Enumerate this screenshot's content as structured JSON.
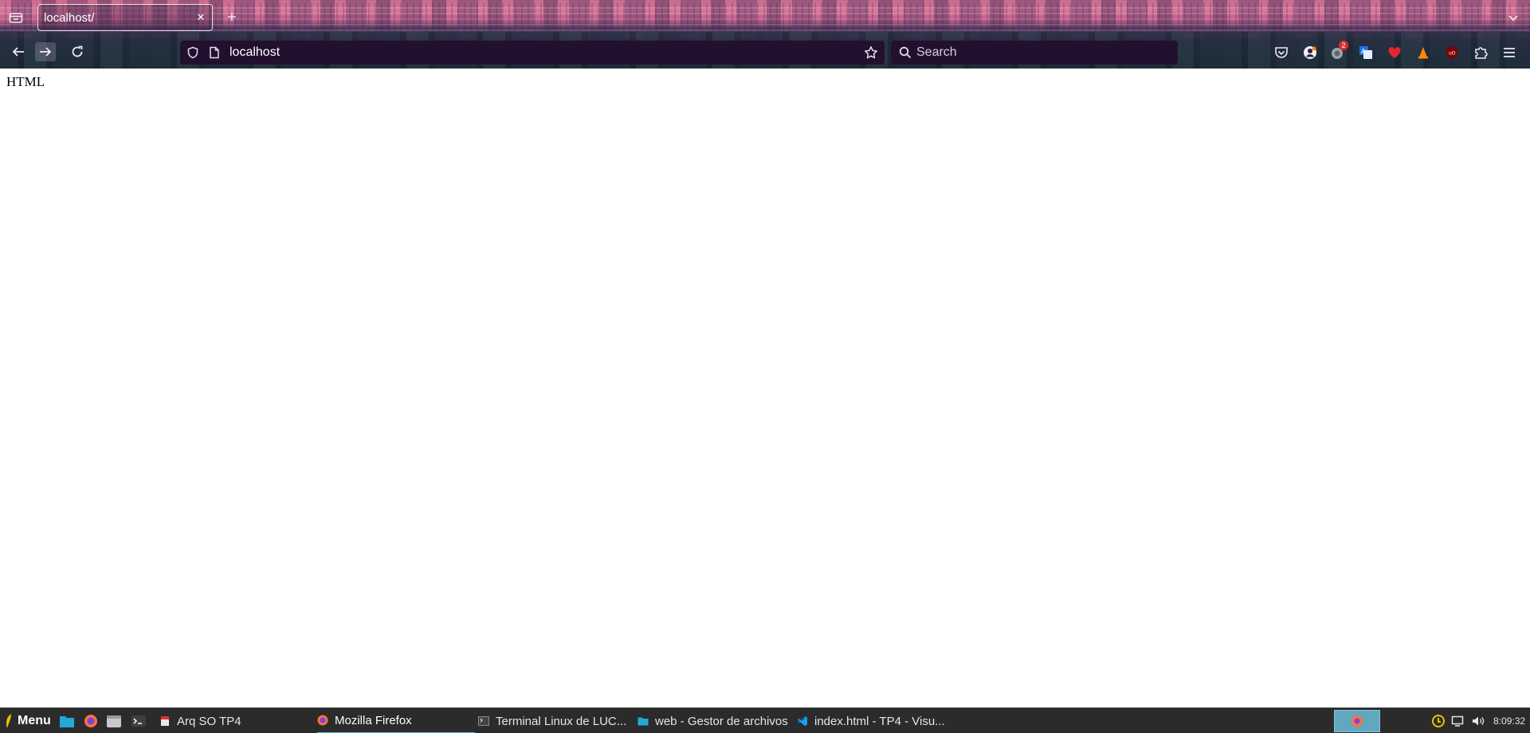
{
  "browser": {
    "tab": {
      "title": "localhost/"
    },
    "url_bar": {
      "url": "localhost"
    },
    "search_bar": {
      "placeholder": "Search"
    },
    "extension_badge": "2",
    "icons": [
      "tab-list-icon",
      "close-icon",
      "plus-icon",
      "chevron-down-icon",
      "back-arrow-icon",
      "forward-arrow-icon",
      "reload-icon",
      "shield-icon",
      "page-icon",
      "star-icon",
      "search-icon",
      "pocket-icon",
      "account-icon",
      "extension-icon",
      "translate-icon",
      "heart-icon",
      "vlc-icon",
      "ublock-icon",
      "puzzle-icon",
      "hamburger-menu-icon"
    ]
  },
  "page": {
    "body_text": "HTML"
  },
  "taskbar": {
    "menu_label": "Menu",
    "windows": [
      {
        "label": "Arq SO TP4"
      },
      {
        "label": "Mozilla Firefox"
      },
      {
        "label": "Terminal Linux de LUC..."
      },
      {
        "label": "web - Gestor de archivos"
      },
      {
        "label": "index.html - TP4 - Visu..."
      }
    ],
    "clock": "8:09:32"
  },
  "colors": {
    "toolbar_field_bg": "#23102f",
    "taskbar_bg": "#2b2b2b",
    "active_window_underline": "#5bc0de",
    "badge_red": "#e02b2b"
  }
}
